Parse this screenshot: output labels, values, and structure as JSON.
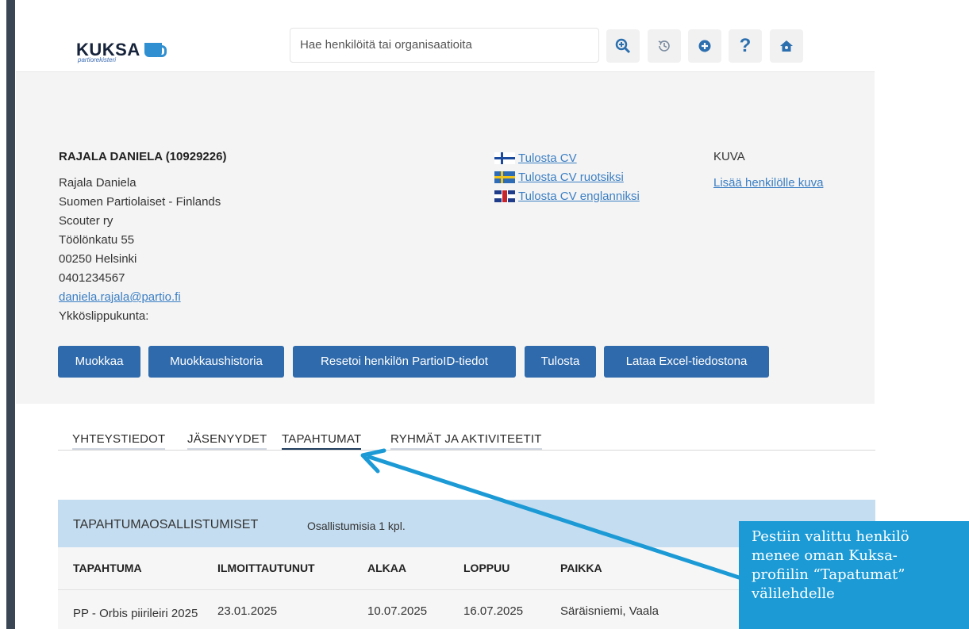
{
  "header": {
    "logo": {
      "word": "KUKSA",
      "sub": "partiorekisteri"
    },
    "search_placeholder": "Hae henkilöitä tai organisaatioita",
    "icons": [
      "search-zoom-icon",
      "history-icon",
      "add-icon",
      "help-icon",
      "home-icon"
    ]
  },
  "profile": {
    "title": "RAJALA DANIELA (10929226)",
    "lines": [
      "Rajala Daniela",
      "Suomen Partiolaiset - Finlands",
      "Scouter ry",
      "Töölönkatu 55",
      "00250 Helsinki",
      "0401234567"
    ],
    "email": "daniela.rajala@partio.fi",
    "primary_group_label": "Ykköslippukunta:",
    "cv_links": [
      "Tulosta CV",
      "Tulosta CV ruotsiksi",
      "Tulosta CV englanniksi"
    ],
    "picture_label": "KUVA",
    "picture_link": "Lisää henkilölle kuva"
  },
  "actions": [
    "Muokkaa",
    "Muokkaushistoria",
    "Resetoi henkilön PartioID-tiedot",
    "Tulosta",
    "Lataa Excel-tiedostona"
  ],
  "tabs": [
    "YHTEYSTIEDOT",
    "JÄSENYYDET",
    "TAPAHTUMAT",
    "RYHMÄT JA AKTIVITEETIT"
  ],
  "active_tab": "TAPAHTUMAT",
  "events": {
    "title": "TAPAHTUMAOSALLISTUMISET",
    "count": "Osallistumisia 1 kpl.",
    "columns": [
      "TAPAHTUMA",
      "ILMOITTAUTUNUT",
      "ALKAA",
      "LOPPUU",
      "PAIKKA"
    ],
    "rows": [
      {
        "event": "PP - Orbis piirileiri 2025",
        "registered": "23.01.2025",
        "starts": "10.07.2025",
        "ends": "16.07.2025",
        "place": "Säräisniemi, Vaala"
      }
    ]
  },
  "callout": {
    "lines": [
      "Pestiin valittu henkilö",
      "menee oman Kuksa-",
      "profiilin “Tapatumat”",
      "välilehdelle"
    ]
  },
  "colors": {
    "primary": "#2f6aac",
    "callout": "#1b9ad6",
    "table_header": "#c5ddf0",
    "link": "#3b7fc4"
  }
}
